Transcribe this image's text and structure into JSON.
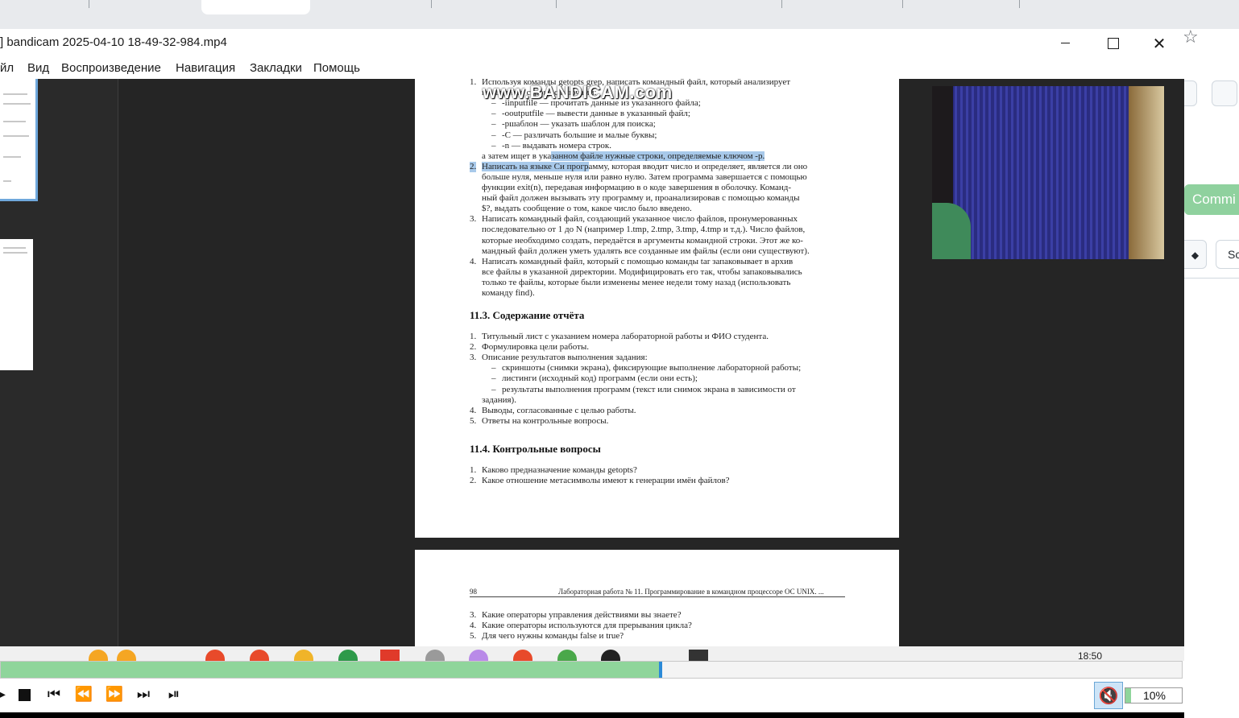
{
  "player": {
    "title": "] bandicam 2025-04-10 18-49-32-984.mp4",
    "menu": [
      "йл",
      "Вид",
      "Воспроизведение",
      "Навигация",
      "Закладки",
      "Помощь"
    ],
    "watermark": "www.BANDICAM.com",
    "progress_fraction": 0.557,
    "volume_label": "10%",
    "volume_fraction": 0.1
  },
  "browser": {
    "commit_label": "Commi",
    "select_label": "Sc",
    "star_icon": "star-icon"
  },
  "taskbar": {
    "time": "18:50"
  },
  "document": {
    "page1": {
      "lines": [
        {
          "n": "1.",
          "text": "Используя команды getopts grep, написать командный файл, который анализирует"
        },
        {
          "n": "",
          "text": "командную строку с ключами:"
        },
        {
          "n": "–",
          "text": "-iinputfile — прочитать данные из указанного файла;"
        },
        {
          "n": "–",
          "text": "-ooutputfile — вывести данные в указанный файл;"
        },
        {
          "n": "–",
          "text": "-pшаблон — указать шаблон для поиска;"
        },
        {
          "n": "–",
          "text": "-C — различать большие и малые буквы;"
        },
        {
          "n": "–",
          "text": "-n — выдавать номера строк."
        },
        {
          "n": "",
          "text_plain": "а затем ищет в ука",
          "text_hl": "занном файле нужные строки, определяемые ключом -p."
        },
        {
          "n": "2.",
          "text_hl": "Написать на языке Си прогр",
          "text_plain": "амму, которая вводит число и определяет, является ли оно"
        },
        {
          "n": "",
          "text": "больше нуля, меньше нуля или равно нулю. Затем программа завершается с помощью"
        },
        {
          "n": "",
          "text": "функции exit(n), передавая информацию в о коде завершения в оболочку. Команд-"
        },
        {
          "n": "",
          "text": "ный файл должен вызывать эту программу и, проанализировав с помощью команды"
        },
        {
          "n": "",
          "text": "$?, выдать сообщение о том, какое число было введено."
        },
        {
          "n": "3.",
          "text": "Написать командный файл, создающий указанное число файлов, пронумерованных"
        },
        {
          "n": "",
          "text": "последовательно от 1 до N (например 1.tmp, 2.tmp, 3.tmp, 4.tmp и т.д.). Число файлов,"
        },
        {
          "n": "",
          "text": "которые необходимо создать, передаётся в аргументы командной строки. Этот же ко-"
        },
        {
          "n": "",
          "text": "мандный файл должен уметь удалять все созданные им файлы (если они существуют)."
        },
        {
          "n": "4.",
          "text": "Написать командный файл, который с помощью команды tar запаковывает в архив"
        },
        {
          "n": "",
          "text": "все файлы в указанной директории. Модифицировать его так, чтобы запаковывались"
        },
        {
          "n": "",
          "text": "только те файлы, которые были изменены менее недели тому назад (использовать"
        },
        {
          "n": "",
          "text": "команду find)."
        }
      ],
      "section1_title": "11.3.   Содержание отчёта",
      "section1_items": [
        {
          "n": "1.",
          "text": "Титульный лист с указанием номера лабораторной работы и ФИО студента."
        },
        {
          "n": "2.",
          "text": "Формулировка цели работы."
        },
        {
          "n": "3.",
          "text": "Описание результатов выполнения задания:"
        },
        {
          "n": "–",
          "text": "скриншоты (снимки экрана), фиксирующие выполнение лабораторной работы;"
        },
        {
          "n": "–",
          "text": "листинги (исходный код) программ (если они есть);"
        },
        {
          "n": "–",
          "text": "результаты выполнения программ (текст или снимок экрана в зависимости от"
        },
        {
          "n": "",
          "text": "задания)."
        },
        {
          "n": "4.",
          "text": "Выводы, согласованные с целью работы."
        },
        {
          "n": "5.",
          "text": "Ответы на контрольные вопросы."
        }
      ],
      "section2_title": "11.4.   Контрольные вопросы",
      "section2_items": [
        {
          "n": "1.",
          "text": "Каково предназначение команды getopts?"
        },
        {
          "n": "2.",
          "text": "Какое отношение метасимволы имеют к генерации имён файлов?"
        }
      ]
    },
    "page2": {
      "page_number": "98",
      "running_head": "Лабораторная работа № 11. Программирование в командном процессоре ОС UNIX. ...",
      "items": [
        {
          "n": "3.",
          "text": "Какие операторы управления действиями вы знаете?"
        },
        {
          "n": "4.",
          "text": "Какие операторы используются для прерывания цикла?"
        },
        {
          "n": "5.",
          "text": "Для чего нужны команды false и true?"
        }
      ]
    }
  },
  "icons": {
    "minimize": "minimize-icon",
    "maximize": "maximize-icon",
    "close": "close-icon",
    "play": "play-icon",
    "stop": "stop-icon",
    "prev": "skip-back-icon",
    "rewind": "rewind-icon",
    "forward": "fast-forward-icon",
    "next": "skip-forward-icon",
    "frame": "frame-step-icon",
    "mute": "mute-icon"
  },
  "colors": {
    "progress": "#8fd59b",
    "selection": "#a8c9ea",
    "knob": "#2b8ad8",
    "commit": "#8fd19e"
  }
}
